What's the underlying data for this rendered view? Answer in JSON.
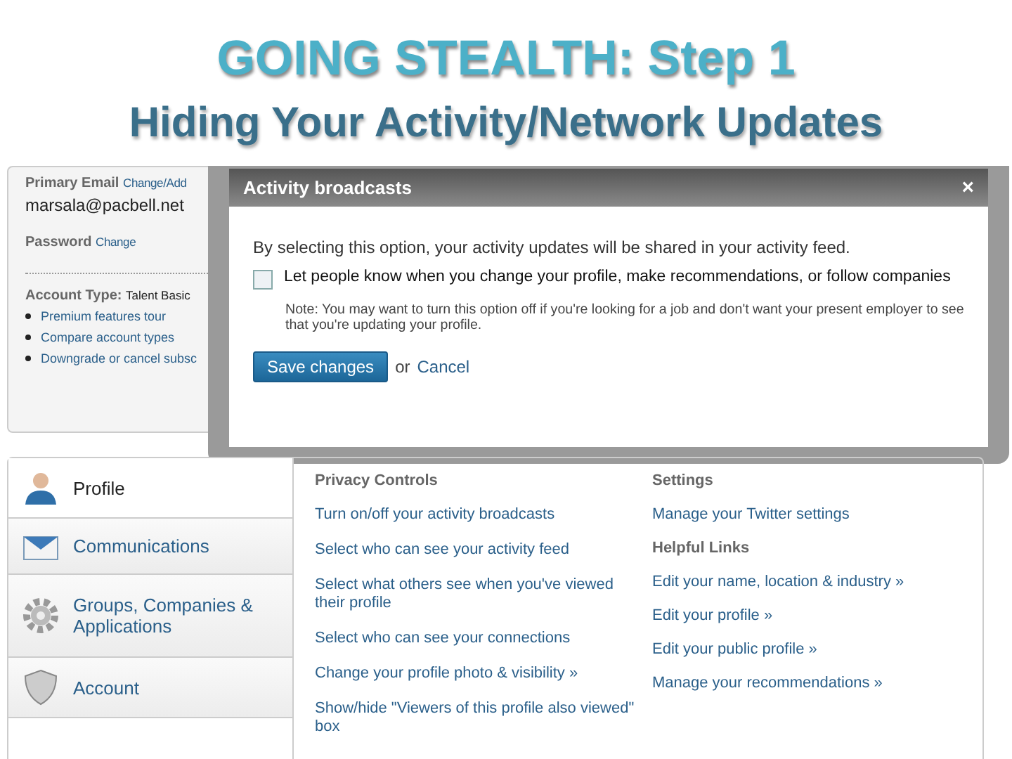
{
  "slide": {
    "title": "GOING STEALTH: Step 1",
    "subtitle": "Hiding Your Activity/Network Updates"
  },
  "account_panel": {
    "email_label": "Primary Email",
    "email_link": "Change/Add",
    "email": "marsala@pacbell.net",
    "password_label": "Password",
    "password_link": "Change",
    "account_type_label": "Account Type:",
    "account_type": "Talent Basic",
    "links": [
      "Premium features tour",
      "Compare account types",
      "Downgrade or cancel subsc"
    ]
  },
  "modal": {
    "title": "Activity broadcasts",
    "close": "×",
    "intro": "By selecting this option, your activity updates will be shared in your activity feed.",
    "option": {
      "label": "Let people know when you change your profile, make recommendations, or follow companies",
      "checked": false
    },
    "note": "Note: You may want to turn this option off if you're looking for a job and don't want your present employer to see that you're updating your profile.",
    "save": "Save changes",
    "or": "or",
    "cancel": "Cancel"
  },
  "nav": [
    {
      "label": "Profile",
      "kind": "person",
      "selected": true
    },
    {
      "label": "Communications",
      "kind": "envelope",
      "selected": false
    },
    {
      "label": "Groups, Companies & Applications",
      "kind": "gear",
      "selected": false
    },
    {
      "label": "Account",
      "kind": "shield",
      "selected": false
    }
  ],
  "privacy": {
    "heading": "Privacy Controls",
    "links": [
      "Turn on/off your activity broadcasts",
      "Select who can see your activity feed",
      "Select what others see when you've viewed their profile",
      "Select who can see your connections",
      "Change your profile photo & visibility »",
      "Show/hide \"Viewers of this profile also viewed\" box"
    ]
  },
  "settings": {
    "heading": "Settings",
    "links": [
      "Manage your Twitter settings"
    ]
  },
  "helpful": {
    "heading": "Helpful Links",
    "links": [
      "Edit your name, location & industry »",
      "Edit your profile »",
      "Edit your public profile »",
      "Manage your recommendations »"
    ]
  }
}
